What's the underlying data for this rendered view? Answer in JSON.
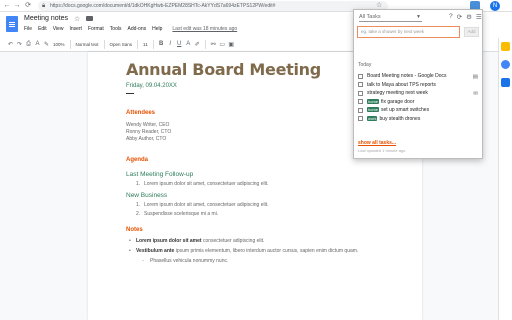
{
  "browser": {
    "url": "https://docs.google.com/document/d/1dkOHKgHwb-EZPEM28SHTc-AkYYdS7a694zETPS12PW/edit#",
    "profile_initial": "N"
  },
  "docs": {
    "title": "Meeting notes",
    "menu": [
      "File",
      "Edit",
      "View",
      "Insert",
      "Format",
      "Tools",
      "Add-ons",
      "Help"
    ],
    "last_edit": "Last edit was 18 minutes ago",
    "toolbar": {
      "zoom": "100%",
      "style": "Normal text",
      "font": "Open Sans",
      "size": "11"
    }
  },
  "document": {
    "title": "Annual Board Meeting",
    "date": "Friday, 09.04.20XX",
    "attendees_heading": "Attendees",
    "attendees": [
      "Wendy Writer, CEO",
      "Ronny Reader, CTO",
      "Abby Author, CTO"
    ],
    "agenda_heading": "Agenda",
    "followup_heading": "Last Meeting Follow-up",
    "followup_items": [
      "Lorem ipsum dolor sit amet, consectetuer adipiscing elit."
    ],
    "newbiz_heading": "New Business",
    "newbiz_items": [
      "Lorem ipsum dolor sit amet, consectetuer adipiscing elit.",
      "Suspendisse scelerisque mi a mi."
    ],
    "notes_heading": "Notes",
    "note1_bold": "Lorem ipsum dolor sit amet",
    "note1_rest": " consectetuer adipiscing elit.",
    "note2_bold": "Vestibulum ante",
    "note2_rest": " ipsum primis elementum, libero interdum auctor cursus, sapien enim dictum quam.",
    "note3": "Phasellus vehicula nonummy nunc."
  },
  "tasks_popup": {
    "list_name": "All Tasks",
    "input_placeholder": "eg. take a shower by next week",
    "add_label": "Add",
    "section": "Today",
    "tasks": [
      {
        "text": "Board Meeting notes - Google Docs",
        "badge": "",
        "icon": "doc-icon"
      },
      {
        "text": "talk to Maya about TPS reports",
        "badge": "",
        "icon": ""
      },
      {
        "text": "strategy meeting next week",
        "badge": "",
        "icon": "email-icon"
      },
      {
        "text": "fix garage door",
        "badge": "home",
        "icon": ""
      },
      {
        "text": "set up smart switches",
        "badge": "home",
        "icon": ""
      },
      {
        "text": "buy stealth drones",
        "badge": "work",
        "icon": ""
      }
    ],
    "show_all": "show all tasks...",
    "last_updated": "Last updated 1 minute ago"
  }
}
